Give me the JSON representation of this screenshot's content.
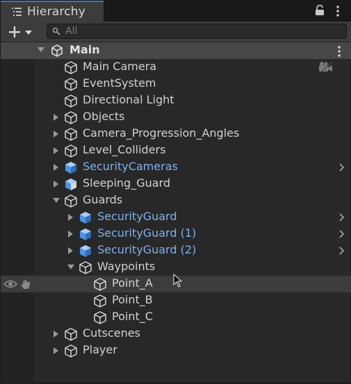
{
  "window": {
    "tab_title": "Hierarchy",
    "tab_icon": "list-icon",
    "lock_icon": "lock-icon",
    "menu_icon": "kebab-menu-icon"
  },
  "toolbar": {
    "add_icon": "plus-icon",
    "dropdown_icon": "chevron-down-icon",
    "search_icon": "search-icon",
    "search_placeholder": "All",
    "search_value": ""
  },
  "scene": {
    "title": "Main",
    "icon": "unity-scene-icon",
    "expanded": true
  },
  "colors": {
    "background": "#282828",
    "header": "#474747",
    "prefab_text": "#7fb1ec",
    "text": "#d2d2d2",
    "tab_accent": "#3a79bb"
  },
  "rows": [
    {
      "label": "Main Camera",
      "depth": 0,
      "foldout": "none",
      "icon": "gameobject-icon",
      "prefab": false,
      "extra": "camera-gizmo-icon"
    },
    {
      "label": "EventSystem",
      "depth": 0,
      "foldout": "none",
      "icon": "gameobject-icon",
      "prefab": false
    },
    {
      "label": "Directional Light",
      "depth": 0,
      "foldout": "none",
      "icon": "gameobject-icon",
      "prefab": false
    },
    {
      "label": "Objects",
      "depth": 0,
      "foldout": "collapsed",
      "icon": "gameobject-icon",
      "prefab": false
    },
    {
      "label": "Camera_Progression_Angles",
      "depth": 0,
      "foldout": "collapsed",
      "icon": "gameobject-icon",
      "prefab": false
    },
    {
      "label": "Level_Colliders",
      "depth": 0,
      "foldout": "collapsed",
      "icon": "gameobject-icon",
      "prefab": false
    },
    {
      "label": "SecurityCameras",
      "depth": 0,
      "foldout": "collapsed",
      "icon": "prefab-icon",
      "prefab": true,
      "chevron": true
    },
    {
      "label": "Sleeping_Guard",
      "depth": 0,
      "foldout": "collapsed",
      "icon": "prefab-variant-icon",
      "prefab": false
    },
    {
      "label": "Guards",
      "depth": 0,
      "foldout": "expanded",
      "icon": "gameobject-icon",
      "prefab": false
    },
    {
      "label": "SecurityGuard",
      "depth": 1,
      "foldout": "collapsed",
      "icon": "prefab-icon",
      "prefab": true,
      "chevron": true
    },
    {
      "label": "SecurityGuard (1)",
      "depth": 1,
      "foldout": "collapsed",
      "icon": "prefab-icon",
      "prefab": true,
      "chevron": true
    },
    {
      "label": "SecurityGuard (2)",
      "depth": 1,
      "foldout": "collapsed",
      "icon": "prefab-icon",
      "prefab": true,
      "chevron": true
    },
    {
      "label": "Waypoints",
      "depth": 1,
      "foldout": "expanded",
      "icon": "gameobject-icon",
      "prefab": false
    },
    {
      "label": "Point_A",
      "depth": 2,
      "foldout": "none",
      "icon": "gameobject-icon",
      "prefab": false,
      "hovered": true
    },
    {
      "label": "Point_B",
      "depth": 2,
      "foldout": "none",
      "icon": "gameobject-icon",
      "prefab": false
    },
    {
      "label": "Point_C",
      "depth": 2,
      "foldout": "none",
      "icon": "gameobject-icon",
      "prefab": false
    },
    {
      "label": "Cutscenes",
      "depth": 0,
      "foldout": "collapsed",
      "icon": "gameobject-icon",
      "prefab": false
    },
    {
      "label": "Player",
      "depth": 0,
      "foldout": "collapsed",
      "icon": "gameobject-icon",
      "prefab": false
    }
  ]
}
